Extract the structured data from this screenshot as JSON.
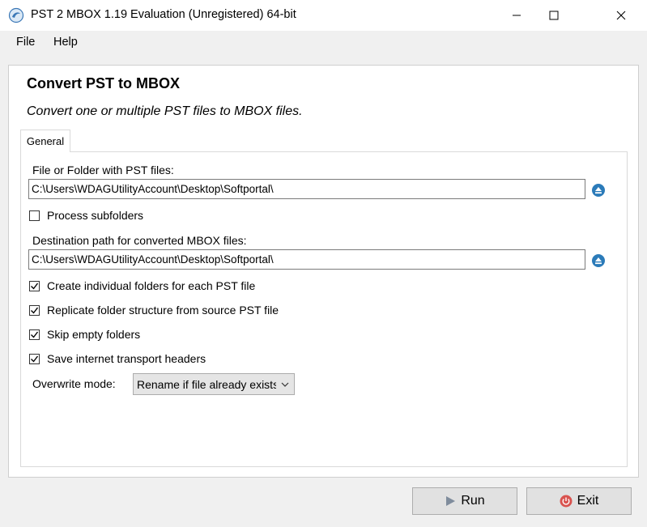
{
  "window": {
    "title": "PST 2 MBOX 1.19 Evaluation (Unregistered) 64-bit"
  },
  "menu": {
    "items": [
      "File",
      "Help"
    ]
  },
  "header": {
    "title": "Convert PST to MBOX",
    "subtitle": "Convert one or multiple PST files to MBOX files."
  },
  "tabs": [
    "General"
  ],
  "source": {
    "label": "File or Folder with PST files:",
    "value": "C:\\Users\\WDAGUtilityAccount\\Desktop\\Softportal\\"
  },
  "process_subfolders": {
    "label": "Process subfolders",
    "checked": false
  },
  "destination": {
    "label": "Destination path for converted MBOX files:",
    "value": "C:\\Users\\WDAGUtilityAccount\\Desktop\\Softportal\\"
  },
  "options": [
    {
      "label": "Create individual folders for each PST file",
      "checked": true
    },
    {
      "label": "Replicate folder structure from source PST file",
      "checked": true
    },
    {
      "label": "Skip empty folders",
      "checked": true
    },
    {
      "label": "Save internet transport headers",
      "checked": true
    }
  ],
  "overwrite": {
    "label": "Overwrite mode:",
    "selected": "Rename if file already exists"
  },
  "buttons": {
    "run": "Run",
    "exit": "Exit"
  },
  "colors": {
    "accent": "#2b7bb9",
    "exit_icon": "#d9534f",
    "run_icon": "#7f8c9c"
  }
}
